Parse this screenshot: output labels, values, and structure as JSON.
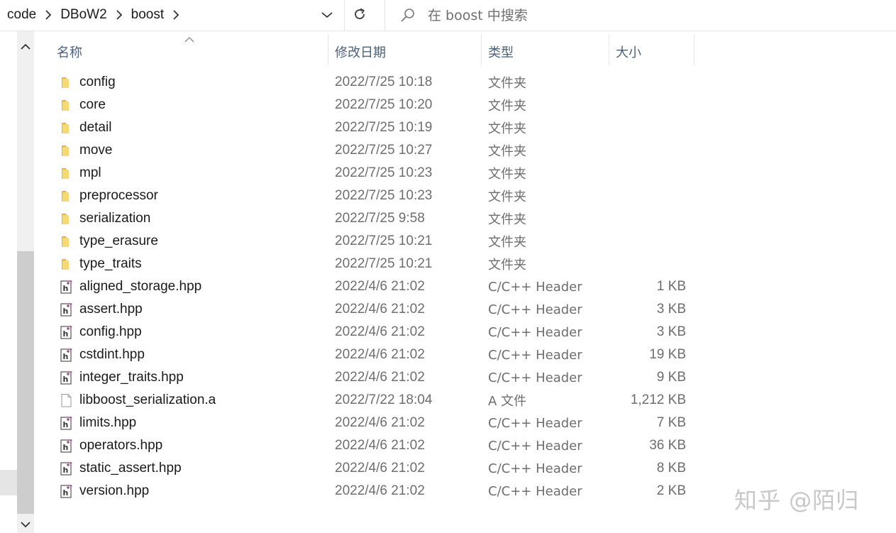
{
  "breadcrumb": [
    "code",
    "DBoW2",
    "boost"
  ],
  "search": {
    "placeholder": "在 boost 中搜索"
  },
  "columns": {
    "name": "名称",
    "date": "修改日期",
    "type": "类型",
    "size": "大小"
  },
  "files": [
    {
      "name": "config",
      "date": "2022/7/25 10:18",
      "type": "文件夹",
      "size": "",
      "icon": "folder-icon"
    },
    {
      "name": "core",
      "date": "2022/7/25 10:20",
      "type": "文件夹",
      "size": "",
      "icon": "folder-icon"
    },
    {
      "name": "detail",
      "date": "2022/7/25 10:19",
      "type": "文件夹",
      "size": "",
      "icon": "folder-icon"
    },
    {
      "name": "move",
      "date": "2022/7/25 10:27",
      "type": "文件夹",
      "size": "",
      "icon": "folder-icon"
    },
    {
      "name": "mpl",
      "date": "2022/7/25 10:23",
      "type": "文件夹",
      "size": "",
      "icon": "folder-icon"
    },
    {
      "name": "preprocessor",
      "date": "2022/7/25 10:23",
      "type": "文件夹",
      "size": "",
      "icon": "folder-icon"
    },
    {
      "name": "serialization",
      "date": "2022/7/25 9:58",
      "type": "文件夹",
      "size": "",
      "icon": "folder-icon"
    },
    {
      "name": "type_erasure",
      "date": "2022/7/25 10:21",
      "type": "文件夹",
      "size": "",
      "icon": "folder-icon"
    },
    {
      "name": "type_traits",
      "date": "2022/7/25 10:21",
      "type": "文件夹",
      "size": "",
      "icon": "folder-icon"
    },
    {
      "name": "aligned_storage.hpp",
      "date": "2022/4/6 21:02",
      "type": "C/C++ Header",
      "size": "1 KB",
      "icon": "header-file-icon"
    },
    {
      "name": "assert.hpp",
      "date": "2022/4/6 21:02",
      "type": "C/C++ Header",
      "size": "3 KB",
      "icon": "header-file-icon"
    },
    {
      "name": "config.hpp",
      "date": "2022/4/6 21:02",
      "type": "C/C++ Header",
      "size": "3 KB",
      "icon": "header-file-icon"
    },
    {
      "name": "cstdint.hpp",
      "date": "2022/4/6 21:02",
      "type": "C/C++ Header",
      "size": "19 KB",
      "icon": "header-file-icon"
    },
    {
      "name": "integer_traits.hpp",
      "date": "2022/4/6 21:02",
      "type": "C/C++ Header",
      "size": "9 KB",
      "icon": "header-file-icon"
    },
    {
      "name": "libboost_serialization.a",
      "date": "2022/7/22 18:04",
      "type": "A 文件",
      "size": "1,212 KB",
      "icon": "blank-file-icon"
    },
    {
      "name": "limits.hpp",
      "date": "2022/4/6 21:02",
      "type": "C/C++ Header",
      "size": "7 KB",
      "icon": "header-file-icon"
    },
    {
      "name": "operators.hpp",
      "date": "2022/4/6 21:02",
      "type": "C/C++ Header",
      "size": "36 KB",
      "icon": "header-file-icon"
    },
    {
      "name": "static_assert.hpp",
      "date": "2022/4/6 21:02",
      "type": "C/C++ Header",
      "size": "8 KB",
      "icon": "header-file-icon"
    },
    {
      "name": "version.hpp",
      "date": "2022/4/6 21:02",
      "type": "C/C++ Header",
      "size": "2 KB",
      "icon": "header-file-icon"
    }
  ],
  "watermark": "知乎 @陌归",
  "colors": {
    "folder": "#f8d775",
    "folder_dark": "#e6b33d",
    "header_accent": "#9b4f96",
    "column_header": "#4c607a"
  }
}
